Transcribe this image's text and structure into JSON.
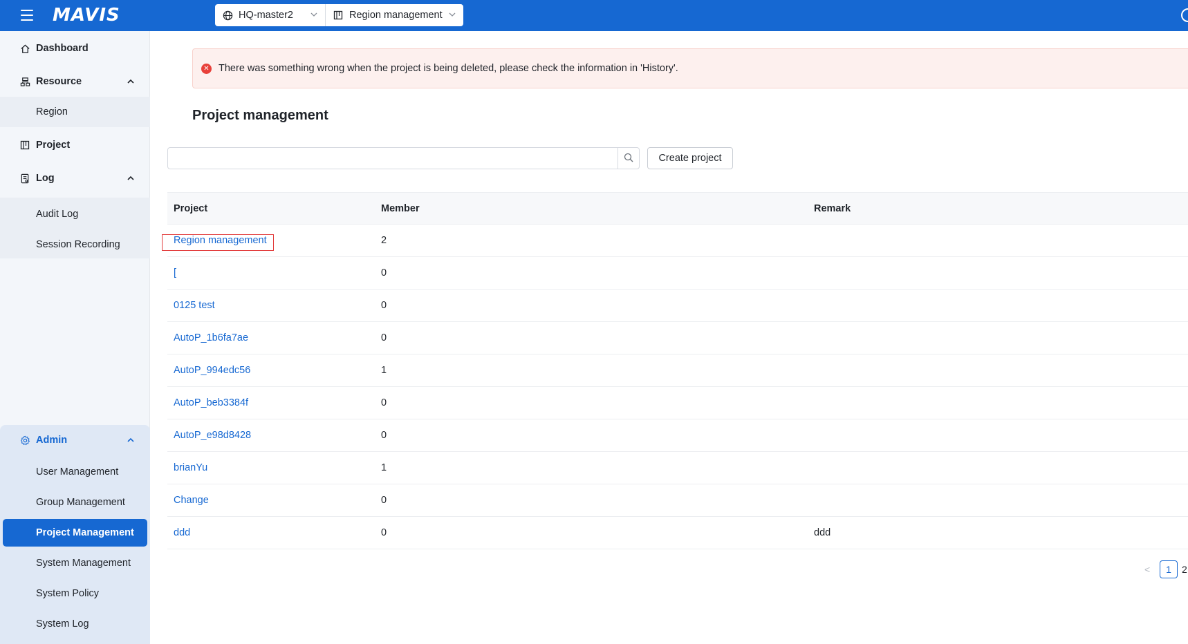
{
  "header": {
    "logo": "MAVIS",
    "icons": {
      "menu": "hamburger-icon",
      "refresh": "refresh-icon"
    },
    "site_selector": {
      "value": "HQ-master2",
      "icon": "globe-icon"
    },
    "project_selector": {
      "value": "Region management",
      "icon": "project-icon"
    }
  },
  "sidebar": {
    "dashboard": "Dashboard",
    "resource": "Resource",
    "region": "Region",
    "project": "Project",
    "log": "Log",
    "audit_log": "Audit Log",
    "session_recording": "Session Recording",
    "admin": "Admin",
    "admin_items": [
      "User Management",
      "Group Management",
      "Project Management",
      "System Management",
      "System Policy",
      "System Log"
    ],
    "active_item": "Project Management"
  },
  "alert": {
    "message": "There was something wrong when the project is being deleted, please check the information in 'History'."
  },
  "page": {
    "title": "Project management",
    "search_placeholder": "",
    "create_button": "Create project"
  },
  "table": {
    "columns": [
      "Project",
      "Member",
      "Remark"
    ],
    "rows": [
      {
        "project": "Region management",
        "member": "2",
        "remark": ""
      },
      {
        "project": "[",
        "member": "0",
        "remark": ""
      },
      {
        "project": "0125 test",
        "member": "0",
        "remark": ""
      },
      {
        "project": "AutoP_1b6fa7ae",
        "member": "0",
        "remark": ""
      },
      {
        "project": "AutoP_994edc56",
        "member": "1",
        "remark": ""
      },
      {
        "project": "AutoP_beb3384f",
        "member": "0",
        "remark": ""
      },
      {
        "project": "AutoP_e98d8428",
        "member": "0",
        "remark": ""
      },
      {
        "project": "brianYu",
        "member": "1",
        "remark": ""
      },
      {
        "project": "Change",
        "member": "0",
        "remark": ""
      },
      {
        "project": "ddd",
        "member": "0",
        "remark": "ddd"
      }
    ]
  },
  "pagination": {
    "prev": "<",
    "current": "1",
    "next_page": "2"
  },
  "colors": {
    "primary": "#1668d2",
    "error": "#e8403a",
    "alert_bg": "#fdf0ee",
    "highlight": "#e23b3b"
  }
}
